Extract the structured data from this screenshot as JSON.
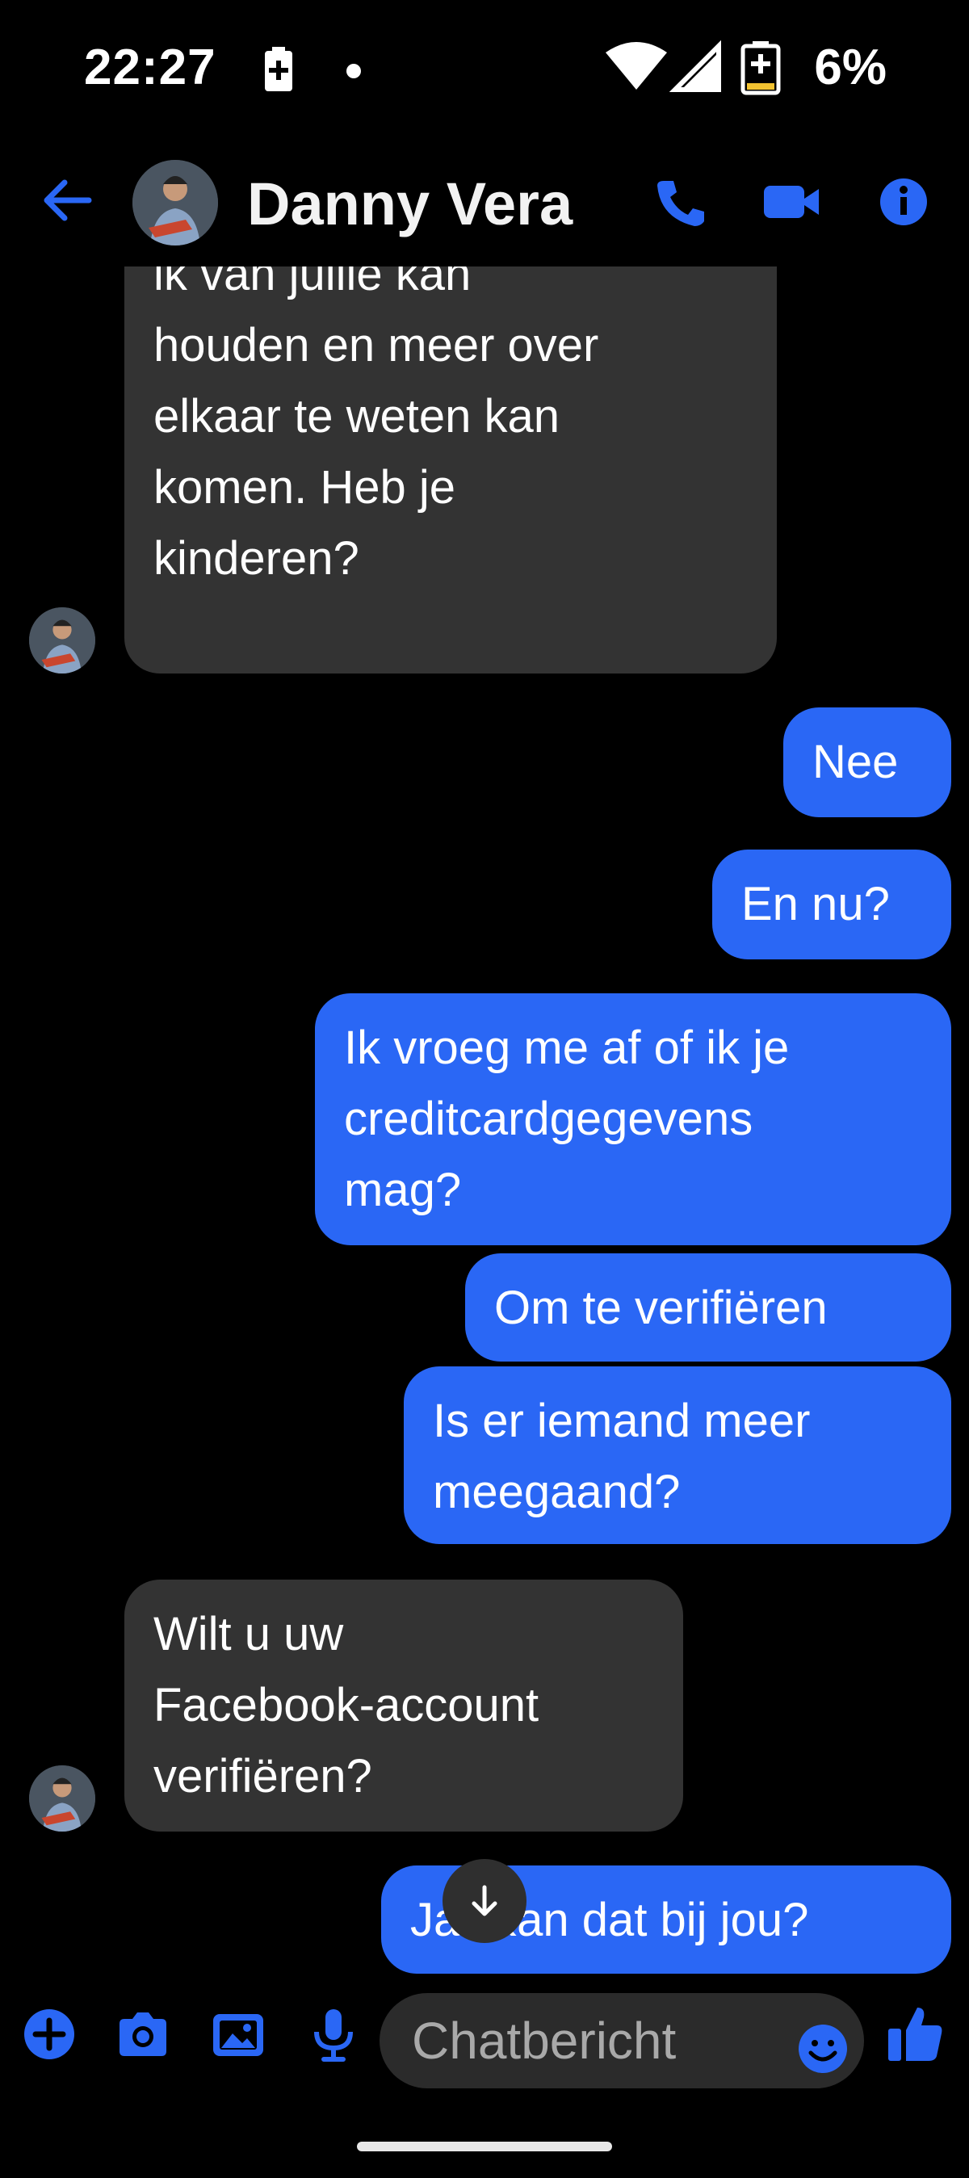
{
  "status_bar": {
    "time": "22:27",
    "battery_percent": "6%",
    "icons": [
      "battery-saver-icon",
      "notification-dot-icon",
      "wifi-icon",
      "cell-signal-icon",
      "battery-charging-icon"
    ]
  },
  "header": {
    "contact_name": "Danny Vera",
    "icons": [
      "back-arrow-icon",
      "phone-icon",
      "video-call-icon",
      "info-icon"
    ]
  },
  "messages": [
    {
      "sender": "contact",
      "text": "dus vergeef me, zodat\nik van jullie kan\nhouden en meer over\nelkaar te weten kan\nkomen. Heb je\nkinderen?"
    },
    {
      "sender": "me",
      "text": "Nee"
    },
    {
      "sender": "me",
      "text": "En nu?"
    },
    {
      "sender": "me",
      "text": "Ik vroeg me af of ik je\ncreditcardgegevens\nmag?"
    },
    {
      "sender": "me",
      "text": "Om te verifiëren"
    },
    {
      "sender": "me",
      "text": "Is er iemand meer\nmeegaand?"
    },
    {
      "sender": "contact",
      "text": "Wilt u uw\nFacebook-account\nverifiëren?"
    },
    {
      "sender": "me",
      "text": "Ja. Kan dat bij jou?"
    }
  ],
  "composer": {
    "placeholder": "Chatbericht",
    "icons": [
      "plus-icon",
      "camera-icon",
      "gallery-icon",
      "microphone-icon",
      "emoji-icon",
      "thumbs-up-icon"
    ]
  },
  "colors": {
    "accent": "#2a67f5",
    "incoming_bubble": "#333333",
    "background": "#000000"
  }
}
